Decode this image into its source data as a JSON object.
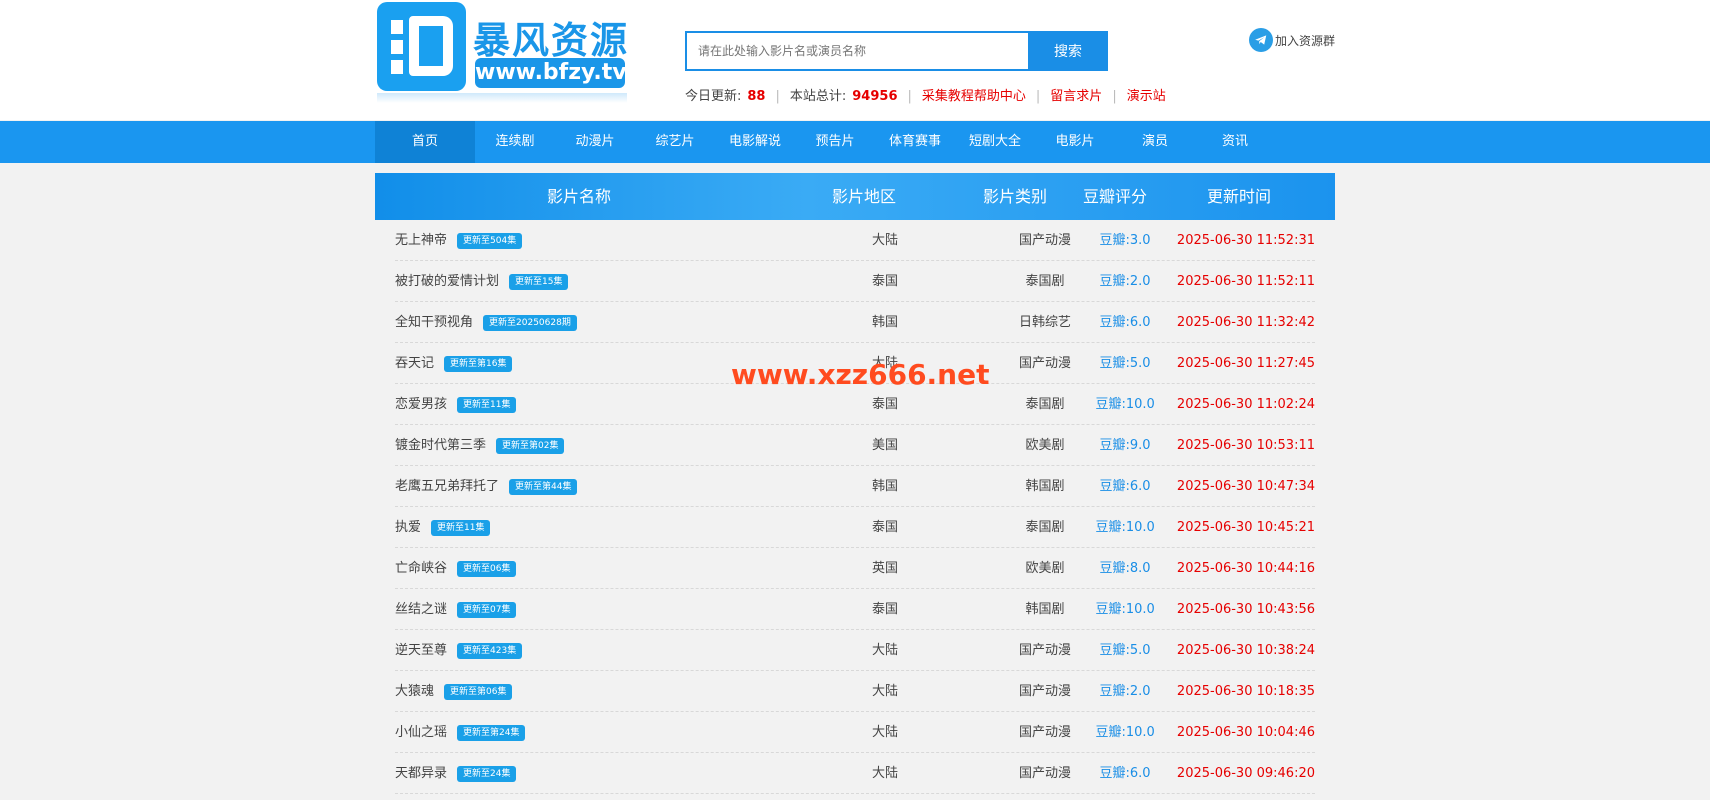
{
  "logo": {
    "cn": "暴风资源",
    "url": "www.bfzy.tv"
  },
  "search": {
    "placeholder": "请在此处输入影片名或演员名称",
    "button": "搜索"
  },
  "stats": {
    "today_label": "今日更新:",
    "today_value": "88",
    "total_label": "本站总计:",
    "total_value": "94956",
    "links": [
      "采集教程帮助中心",
      "留言求片",
      "演示站"
    ]
  },
  "telegram": {
    "label": "加入资源群",
    "icon": "telegram-icon"
  },
  "nav": {
    "items": [
      "首页",
      "连续剧",
      "动漫片",
      "综艺片",
      "电影解说",
      "预告片",
      "体育赛事",
      "短剧大全",
      "电影片",
      "演员",
      "资讯"
    ],
    "active_index": 0
  },
  "table": {
    "headers": {
      "name": "影片名称",
      "area": "影片地区",
      "category": "影片类别",
      "score": "豆瓣评分",
      "time": "更新时间"
    },
    "rows": [
      {
        "name": "无上神帝",
        "badge": "更新至504集",
        "area": "大陆",
        "category": "国产动漫",
        "score": "豆瓣:3.0",
        "time": "2025-06-30 11:52:31"
      },
      {
        "name": "被打破的爱情计划",
        "badge": "更新至15集",
        "area": "泰国",
        "category": "泰国剧",
        "score": "豆瓣:2.0",
        "time": "2025-06-30 11:52:11"
      },
      {
        "name": "全知干预视角",
        "badge": "更新至20250628期",
        "area": "韩国",
        "category": "日韩综艺",
        "score": "豆瓣:6.0",
        "time": "2025-06-30 11:32:42"
      },
      {
        "name": "吞天记",
        "badge": "更新至第16集",
        "area": "大陆",
        "category": "国产动漫",
        "score": "豆瓣:5.0",
        "time": "2025-06-30 11:27:45"
      },
      {
        "name": "恋爱男孩",
        "badge": "更新至11集",
        "area": "泰国",
        "category": "泰国剧",
        "score": "豆瓣:10.0",
        "time": "2025-06-30 11:02:24"
      },
      {
        "name": "镀金时代第三季",
        "badge": "更新至第02集",
        "area": "美国",
        "category": "欧美剧",
        "score": "豆瓣:9.0",
        "time": "2025-06-30 10:53:11"
      },
      {
        "name": "老鹰五兄弟拜托了",
        "badge": "更新至第44集",
        "area": "韩国",
        "category": "韩国剧",
        "score": "豆瓣:6.0",
        "time": "2025-06-30 10:47:34"
      },
      {
        "name": "执爱",
        "badge": "更新至11集",
        "area": "泰国",
        "category": "泰国剧",
        "score": "豆瓣:10.0",
        "time": "2025-06-30 10:45:21"
      },
      {
        "name": "亡命峡谷",
        "badge": "更新至06集",
        "area": "英国",
        "category": "欧美剧",
        "score": "豆瓣:8.0",
        "time": "2025-06-30 10:44:16"
      },
      {
        "name": "丝结之谜",
        "badge": "更新至07集",
        "area": "泰国",
        "category": "韩国剧",
        "score": "豆瓣:10.0",
        "time": "2025-06-30 10:43:56"
      },
      {
        "name": "逆天至尊",
        "badge": "更新至423集",
        "area": "大陆",
        "category": "国产动漫",
        "score": "豆瓣:5.0",
        "time": "2025-06-30 10:38:24"
      },
      {
        "name": "大猿魂",
        "badge": "更新至第06集",
        "area": "大陆",
        "category": "国产动漫",
        "score": "豆瓣:2.0",
        "time": "2025-06-30 10:18:35"
      },
      {
        "name": "小仙之瑶",
        "badge": "更新至第24集",
        "area": "大陆",
        "category": "国产动漫",
        "score": "豆瓣:10.0",
        "time": "2025-06-30 10:04:46"
      },
      {
        "name": "天都异录",
        "badge": "更新至24集",
        "area": "大陆",
        "category": "国产动漫",
        "score": "豆瓣:6.0",
        "time": "2025-06-30 09:46:20"
      }
    ]
  },
  "watermark": "www.xzz666.net",
  "colors": {
    "brand_blue": "#1a96f0",
    "accent_red": "#e60000",
    "score_blue": "#1a8ee6"
  }
}
